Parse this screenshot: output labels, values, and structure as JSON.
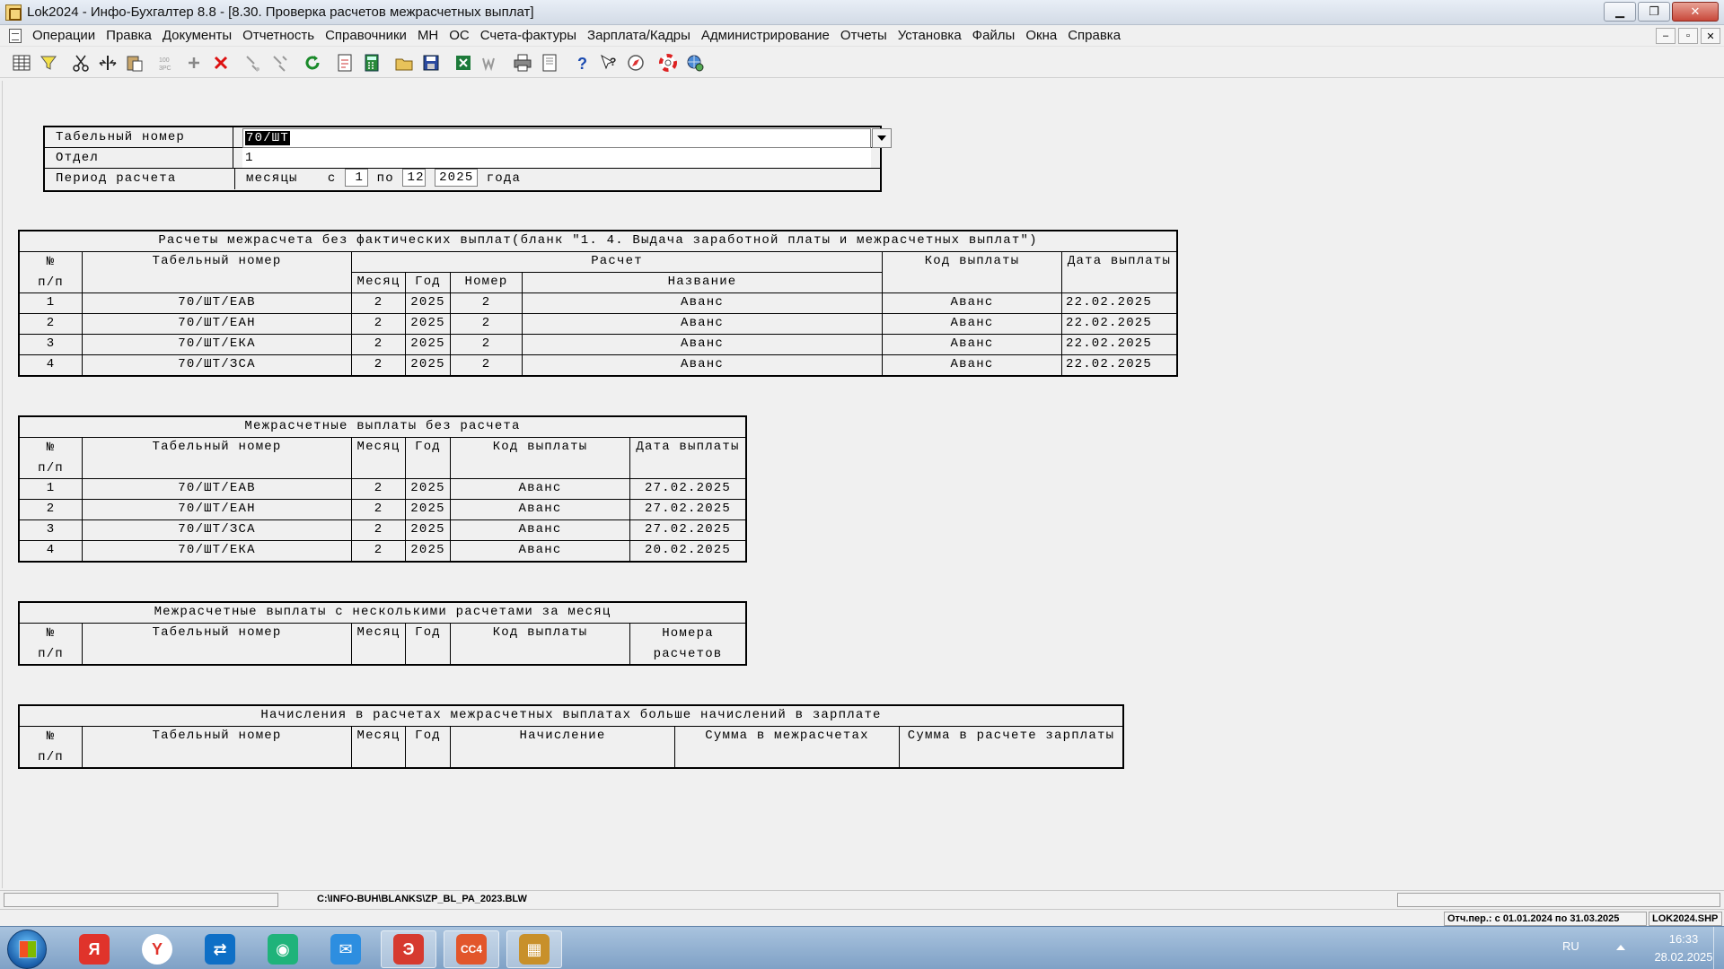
{
  "window": {
    "title": "Lok2024 - Инфо-Бухгалтер 8.8 - [8.30. Проверка расчетов межрасчетных выплат]",
    "min_glyph": "▁",
    "restore_glyph": "❐",
    "close_glyph": "✕"
  },
  "menu": {
    "items": [
      "Операции",
      "Правка",
      "Документы",
      "Отчетность",
      "Справочники",
      "МН",
      "ОС",
      "Счета-фактуры",
      "Зарплата/Кадры",
      "Администрирование",
      "Отчеты",
      "Установка",
      "Файлы",
      "Окна",
      "Справка"
    ],
    "mdi_min": "–",
    "mdi_restore": "▫",
    "mdi_close": "✕"
  },
  "toolbar": {
    "icons": [
      "grid-icon",
      "filter-icon",
      "cut-icon",
      "split-icon",
      "paste-icon",
      "number-icon",
      "add-icon",
      "delete-icon",
      "tools-icon",
      "tools2-icon",
      "refresh-icon",
      "report-icon",
      "calculator-icon",
      "open-folder-icon",
      "save-icon",
      "excel-icon",
      "word-icon",
      "print-icon",
      "preview-icon",
      "help-icon",
      "context-help-icon",
      "compass-icon",
      "lifebuoy-icon",
      "globe-icon"
    ]
  },
  "params": {
    "tab_label": "Табельный номер",
    "tab_value": "70/ШТ",
    "dept_label": "Отдел",
    "dept_value": "1",
    "period_label": "Период расчета",
    "period_months": "месяцы",
    "period_from_word": "с",
    "period_from": "1",
    "period_to_word": "по",
    "period_to": "12",
    "period_year": "2025",
    "period_year_word": "года"
  },
  "t1": {
    "title": "Расчеты межрасчета без фактических выплат(бланк \"1. 4. Выдача заработной платы и межрасчетных выплат\")",
    "h_num1": "№",
    "h_num2": "п/п",
    "h_tab": "Табельный номер",
    "h_calc": "Расчет",
    "h_month": "Месяц",
    "h_year": "Год",
    "h_number": "Номер",
    "h_name": "Название",
    "h_code": "Код выплаты",
    "h_date": "Дата выплаты",
    "rows": [
      {
        "n": "1",
        "tab": "70/ШТ/ЕАВ",
        "month": "2",
        "year": "2025",
        "num": "2",
        "name": "Аванс",
        "code": "Аванс",
        "date": "22.02.2025"
      },
      {
        "n": "2",
        "tab": "70/ШТ/ЕАН",
        "month": "2",
        "year": "2025",
        "num": "2",
        "name": "Аванс",
        "code": "Аванс",
        "date": "22.02.2025"
      },
      {
        "n": "3",
        "tab": "70/ШТ/ЕКА",
        "month": "2",
        "year": "2025",
        "num": "2",
        "name": "Аванс",
        "code": "Аванс",
        "date": "22.02.2025"
      },
      {
        "n": "4",
        "tab": "70/ШТ/ЗСА",
        "month": "2",
        "year": "2025",
        "num": "2",
        "name": "Аванс",
        "code": "Аванс",
        "date": "22.02.2025"
      }
    ]
  },
  "t2": {
    "title": "Межрасчетные выплаты без расчета",
    "h_num1": "№",
    "h_num2": "п/п",
    "h_tab": "Табельный номер",
    "h_month": "Месяц",
    "h_year": "Год",
    "h_code": "Код выплаты",
    "h_date": "Дата выплаты",
    "rows": [
      {
        "n": "1",
        "tab": "70/ШТ/ЕАВ",
        "month": "2",
        "year": "2025",
        "code": "Аванс",
        "date": "27.02.2025"
      },
      {
        "n": "2",
        "tab": "70/ШТ/ЕАН",
        "month": "2",
        "year": "2025",
        "code": "Аванс",
        "date": "27.02.2025"
      },
      {
        "n": "3",
        "tab": "70/ШТ/ЗСА",
        "month": "2",
        "year": "2025",
        "code": "Аванс",
        "date": "27.02.2025"
      },
      {
        "n": "4",
        "tab": "70/ШТ/ЕКА",
        "month": "2",
        "year": "2025",
        "code": "Аванс",
        "date": "20.02.2025"
      }
    ]
  },
  "t3": {
    "title": "Межрасчетные выплаты с несколькими расчетами за месяц",
    "h_num1": "№",
    "h_num2": "п/п",
    "h_tab": "Табельный номер",
    "h_month": "Месяц",
    "h_year": "Год",
    "h_code": "Код выплаты",
    "h_nums1": "Номера",
    "h_nums2": "расчетов"
  },
  "t4": {
    "title": "Начисления в расчетах межрасчетных выплатах больше начислений в зарплате",
    "h_num1": "№",
    "h_num2": "п/п",
    "h_tab": "Табельный номер",
    "h_month": "Месяц",
    "h_year": "Год",
    "h_accr": "Начисление",
    "h_sum_inter": "Сумма в межрасчетах",
    "h_sum_salary": "Сумма в расчете зарплаты"
  },
  "status": {
    "path": "C:\\INFO-BUH\\BLANKS\\ZP_BL_PA_2023.BLW",
    "period": "Отч.пер.: с 01.01.2024 по 31.03.2025",
    "file": "LOK2024.SHP"
  },
  "taskbar": {
    "apps": [
      {
        "name": "yandex-browser-icon",
        "label": "Я",
        "color": "#e0332b"
      },
      {
        "name": "yandex-icon",
        "label": "Y",
        "color": "#ffffff"
      },
      {
        "name": "teamviewer-icon",
        "label": "⇄",
        "color": "#0e6fc6"
      },
      {
        "name": "messenger-green-icon",
        "label": "◉",
        "color": "#1fb37a"
      },
      {
        "name": "messenger-blue-icon",
        "label": "✉",
        "color": "#2d8ee0"
      },
      {
        "name": "antivirus-icon",
        "label": "Э",
        "color": "#d63a2f"
      },
      {
        "name": "cc4-icon",
        "label": "CC4",
        "color": "#e2562b"
      },
      {
        "name": "info-buh-icon",
        "label": "▦",
        "color": "#c8902a"
      }
    ],
    "lang": "RU",
    "time": "16:33",
    "date": "28.02.2025"
  }
}
